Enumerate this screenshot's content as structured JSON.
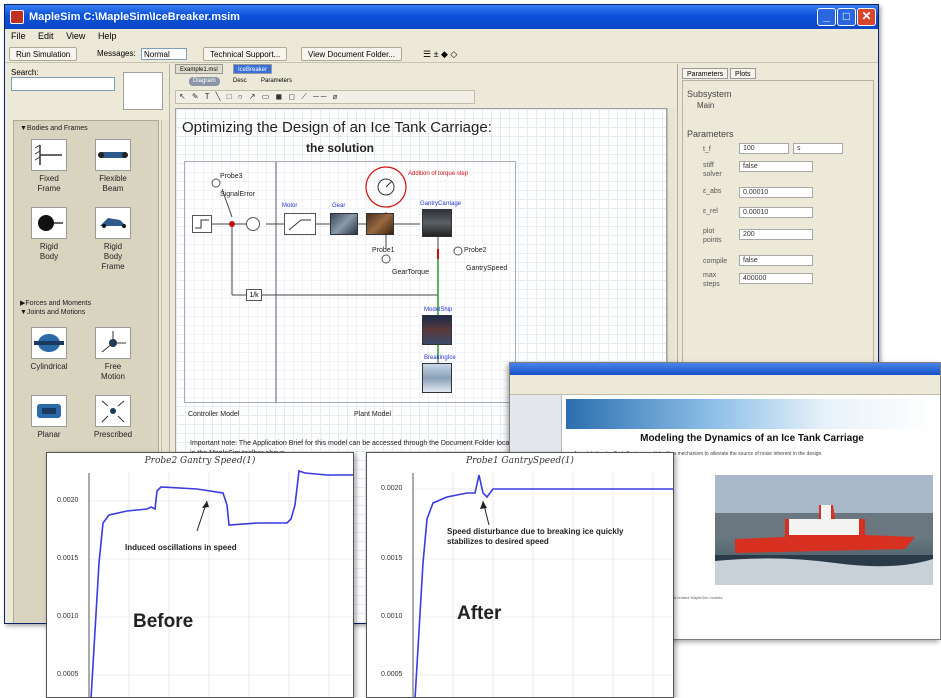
{
  "window": {
    "title": "MapleSim C:\\MapleSim\\IceBreaker.msim",
    "menu": [
      "File",
      "Edit",
      "View",
      "Help"
    ]
  },
  "toolbar": {
    "run_simulation": "Run Simulation",
    "messages_label": "Messages:",
    "messages_value": "Normal",
    "technical_support": "Technical Support...",
    "view_document_folder": "View Document Folder...",
    "icons": "☰ ± ◆ ◇"
  },
  "left_pane": {
    "search_label": "Search:",
    "search_value": "",
    "sections": {
      "bodies": "▼Bodies and Frames",
      "forces": "▶Forces and Moments",
      "joints": "▼Joints and Motions"
    },
    "components": {
      "fixed_frame": [
        "Fixed",
        "Frame"
      ],
      "flexible_beam": [
        "Flexible",
        "Beam"
      ],
      "rigid_body": [
        "Rigid",
        "Body"
      ],
      "rigid_body_frame": [
        "Rigid",
        "Body",
        "Frame"
      ],
      "cylindrical": [
        "Cylindrical"
      ],
      "free_motion": [
        "Free",
        "Motion"
      ],
      "planar": [
        "Planar"
      ],
      "prescribed": [
        "Prescribed"
      ]
    }
  },
  "doc": {
    "tabs": [
      "Example1.msl",
      "IceBreaker"
    ],
    "subtabs": [
      "Diagram",
      "Desc",
      "Parameters"
    ],
    "edit_tools": "↖ ✎ T ╲ □ ○ ↗ ▭ ◼ ◻ ⟋ ── ⌀",
    "title": "Optimizing the Design of an Ice Tank Carriage:",
    "subtitle": "the solution",
    "controller_label": "Controller Model",
    "plant_label": "Plant Model",
    "probes": {
      "probe3": "Probe3",
      "signal_error": "SignalError",
      "probe1": "Probe1",
      "gear_torque": "GearTorque",
      "probe2": "Probe2",
      "gantry_speed": "GantrySpeed"
    },
    "blocks": {
      "motor": "Motor",
      "gear": "Gear",
      "gantry_carriage": "GantryCarriage",
      "model_ship": "ModelShip",
      "breaking_ice": "BreakingIce"
    },
    "red_note": "Addition of torque step",
    "note": "Important note:  The Application Brief for this model can be accessed through the Document Folder located in the MapleSim toolbar above."
  },
  "right_pane": {
    "tabs": [
      "Parameters",
      "Plots"
    ],
    "subsystem_label": "Subsystem",
    "subsystem_value": "Main",
    "parameters_label": "Parameters",
    "params": [
      {
        "name": "t_f",
        "value": "100",
        "unit": "s"
      },
      {
        "name": "stiff solver",
        "value": "false"
      },
      {
        "name": "ε_abs",
        "value": "0.00010"
      },
      {
        "name": "ε_rel",
        "value": "0.00010"
      },
      {
        "name": "plot points",
        "value": "200"
      },
      {
        "name": "compile",
        "value": "false"
      },
      {
        "name": "max steps",
        "value": "400000"
      }
    ]
  },
  "browser": {
    "heading": "Modeling the Dynamics of an Ice Tank Carriage",
    "body": "A model of an Ice Tank Carriage and identify a mechanism to alleviate the source of noise inherent in the design.",
    "foot": "Contact Maplesoft for more information on this application and related MapleSim models."
  },
  "graph_before": {
    "title": "Probe2 Gantry Speed(1)",
    "yticks": [
      "0.0020",
      "0.0015",
      "0.0010",
      "0.0005"
    ],
    "annotation": "Induced oscillations in speed",
    "label": "Before"
  },
  "graph_after": {
    "title": "Probe1 GantrySpeed(1)",
    "yticks": [
      "0.0020",
      "0.0015",
      "0.0010",
      "0.0005"
    ],
    "annotation": "Speed disturbance due to breaking ice quickly stabilizes to desired speed",
    "label": "After"
  },
  "colors": {
    "titlebar": "#0a50d8",
    "chrome": "#ece9d8",
    "plot_line": "#3a3ae0",
    "annotation_red": "#d01010"
  }
}
